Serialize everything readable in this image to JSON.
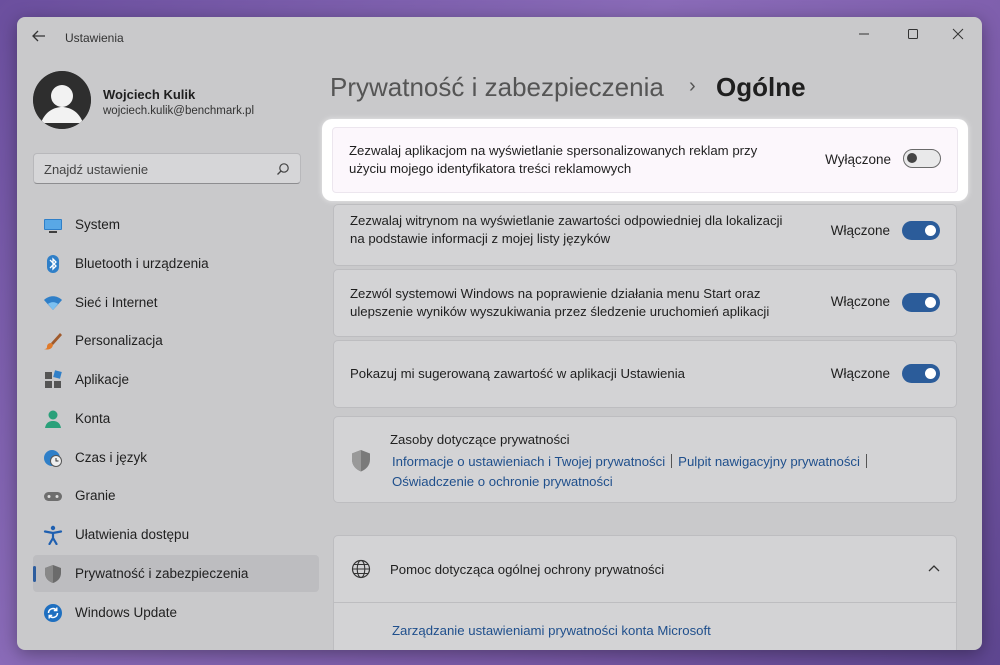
{
  "window": {
    "title": "Ustawienia"
  },
  "profile": {
    "name": "Wojciech Kulik",
    "email": "wojciech.kulik@benchmark.pl"
  },
  "search": {
    "placeholder": "Znajdź ustawienie"
  },
  "nav": {
    "items": [
      {
        "label": "System",
        "icon": "monitor-icon"
      },
      {
        "label": "Bluetooth i urządzenia",
        "icon": "bluetooth-icon"
      },
      {
        "label": "Sieć i Internet",
        "icon": "wifi-icon"
      },
      {
        "label": "Personalizacja",
        "icon": "brush-icon"
      },
      {
        "label": "Aplikacje",
        "icon": "apps-icon"
      },
      {
        "label": "Konta",
        "icon": "person-icon"
      },
      {
        "label": "Czas i język",
        "icon": "clock-globe-icon"
      },
      {
        "label": "Granie",
        "icon": "gamepad-icon"
      },
      {
        "label": "Ułatwienia dostępu",
        "icon": "accessibility-icon"
      },
      {
        "label": "Prywatność i zabezpieczenia",
        "icon": "shield-icon",
        "active": true
      },
      {
        "label": "Windows Update",
        "icon": "update-icon"
      }
    ]
  },
  "header": {
    "parent": "Prywatność i zabezpieczenia",
    "separator": "›",
    "current": "Ogólne"
  },
  "settings": [
    {
      "text": "Zezwalaj aplikacjom na wyświetlanie spersonalizowanych reklam przy użyciu mojego identyfikatora treści reklamowych",
      "status": "Wyłączone",
      "on": false
    },
    {
      "text": "Zezwalaj witrynom na wyświetlanie zawartości odpowiedniej dla lokalizacji na podstawie informacji z mojej listy języków",
      "status": "Włączone",
      "on": true
    },
    {
      "text": "Zezwól systemowi Windows na poprawienie działania menu Start oraz ulepszenie wyników wyszukiwania przez śledzenie uruchomień aplikacji",
      "status": "Włączone",
      "on": true
    },
    {
      "text": "Pokazuj mi sugerowaną zawartość w aplikacji Ustawienia",
      "status": "Włączone",
      "on": true
    }
  ],
  "resources": {
    "title": "Zasoby dotyczące prywatności",
    "links": [
      "Informacje o ustawieniach i Twojej prywatności",
      "Pulpit nawigacyjny prywatności",
      "Oświadczenie o ochronie prywatności"
    ]
  },
  "help": {
    "title": "Pomoc dotycząca ogólnej ochrony prywatności",
    "link": "Zarządzanie ustawieniami prywatności konta Microsoft"
  },
  "colors": {
    "accent": "#2b5c9a",
    "link": "#1f4f8c"
  }
}
